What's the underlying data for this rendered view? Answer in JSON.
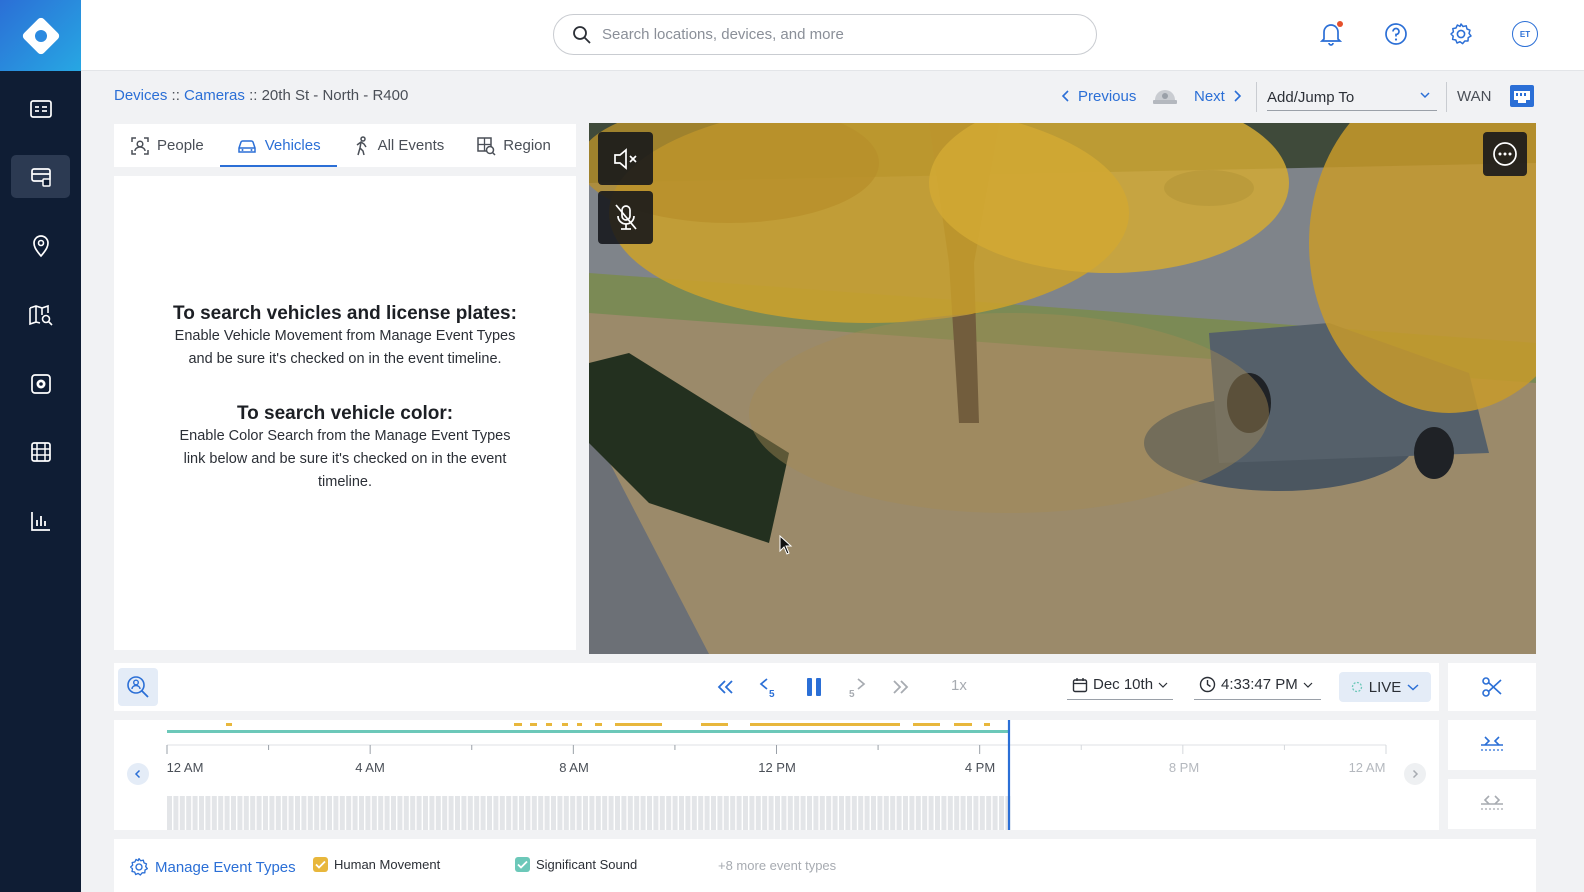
{
  "search": {
    "placeholder": "Search locations, devices, and more"
  },
  "topbar": {
    "avatar_initials": "ET"
  },
  "breadcrumb": {
    "devices": "Devices",
    "cameras": "Cameras",
    "sep": "::",
    "current": "20th St - North - R400"
  },
  "nav": {
    "previous": "Previous",
    "next": "Next",
    "jump_to": "Add/Jump To",
    "wan": "WAN"
  },
  "tabs": [
    {
      "label": "People",
      "icon": "person-scan-icon"
    },
    {
      "label": "Vehicles",
      "icon": "car-icon"
    },
    {
      "label": "All Events",
      "icon": "walking-person-icon"
    },
    {
      "label": "Region",
      "icon": "region-icon"
    }
  ],
  "info": {
    "heading1": "To search vehicles and license plates:",
    "body1": "Enable Vehicle Movement from Manage Event Types and be sure it's checked on in the event timeline.",
    "heading2": "To search vehicle color:",
    "body2": "Enable Color Search from the Manage Event Types link below and be sure it's checked on in the event timeline."
  },
  "controls": {
    "speed": "1x",
    "date": "Dec 10th",
    "time": "4:33:47 PM",
    "live": "LIVE",
    "skip_back_seconds": "5",
    "skip_fwd_seconds": "5"
  },
  "timeline": {
    "labels": [
      "12 AM",
      "4 AM",
      "8 AM",
      "12 PM",
      "4 PM",
      "8 PM",
      "12 AM"
    ],
    "current_position": 0.699
  },
  "footer": {
    "manage": "Manage Event Types",
    "event1": "Human Movement",
    "event2": "Significant Sound",
    "more": "+8 more event types"
  },
  "colors": {
    "accent": "#2b6fd6",
    "sidebar": "#0f1d34",
    "event_yellow": "#e8b73c",
    "event_teal": "#6cc8b9"
  }
}
